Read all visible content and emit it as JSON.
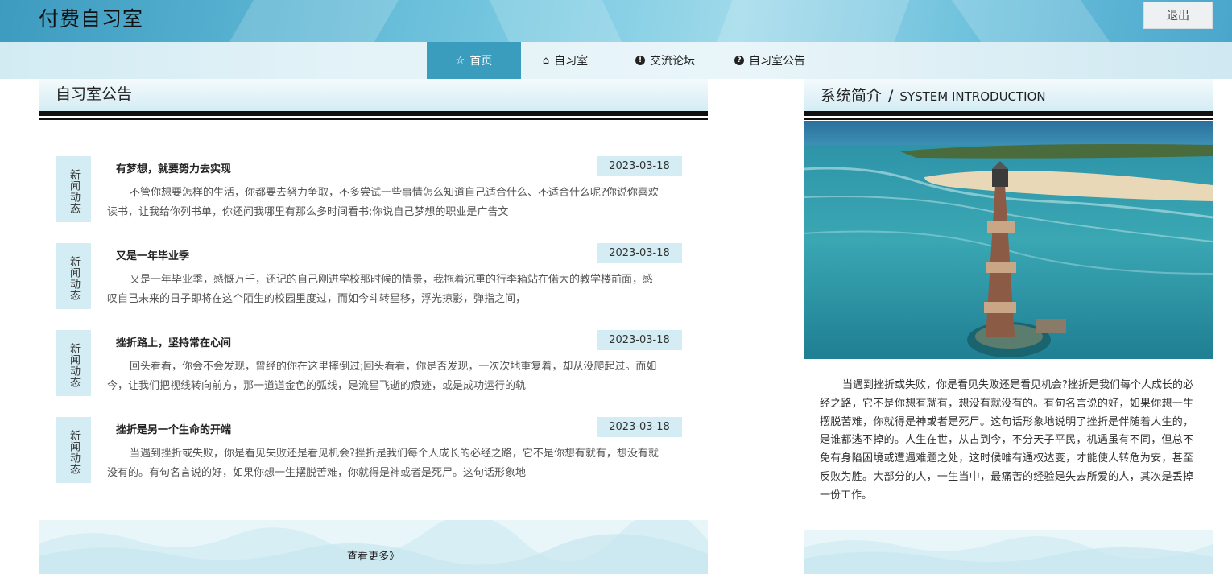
{
  "header": {
    "site_title": "付费自习室",
    "logout_label": "退出"
  },
  "nav": {
    "items": [
      {
        "icon": "star-icon",
        "label": "首页",
        "active": true
      },
      {
        "icon": "home-icon",
        "label": "自习室",
        "active": false
      },
      {
        "icon": "exclamation-circle-icon",
        "label": "交流论坛",
        "active": false
      },
      {
        "icon": "question-circle-icon",
        "label": "自习室公告",
        "active": false
      }
    ]
  },
  "announcements": {
    "title": "自习室公告",
    "tag_label": "新闻动态",
    "items": [
      {
        "title": "有梦想，就要努力去实现",
        "date": "2023-03-18",
        "body": "不管你想要怎样的生活，你都要去努力争取，不多尝试一些事情怎么知道自己适合什么、不适合什么呢?你说你喜欢读书，让我给你列书单，你还问我哪里有那么多时间看书;你说自己梦想的职业是广告文"
      },
      {
        "title": "又是一年毕业季",
        "date": "2023-03-18",
        "body": "又是一年毕业季，感慨万千，还记的自己刚进学校那时候的情景，我拖着沉重的行李箱站在偌大的教学楼前面，感叹自己未来的日子即将在这个陌生的校园里度过，而如今斗转星移，浮光掠影，弹指之间，"
      },
      {
        "title": "挫折路上，坚持常在心间",
        "date": "2023-03-18",
        "body": "回头看看，你会不会发现，曾经的你在这里摔倒过;回头看看，你是否发现，一次次地重复着，却从没爬起过。而如今，让我们把视线转向前方，那一道道金色的弧线，是流星飞逝的痕迹，或是成功运行的轨"
      },
      {
        "title": "挫折是另一个生命的开端",
        "date": "2023-03-18",
        "body": "当遇到挫折或失败，你是看见失败还是看见机会?挫折是我们每个人成长的必经之路，它不是你想有就有，想没有就没有的。有句名言说的好，如果你想一生摆脱苦难，你就得是神或者是死尸。这句话形象地"
      }
    ],
    "more_label": "查看更多》"
  },
  "intro": {
    "title_cn": "系统简介",
    "title_sep": "/",
    "title_en": "SYSTEM INTRODUCTION",
    "image_label": "lighthouse-photo",
    "text": "当遇到挫折或失败，你是看见失败还是看见机会?挫折是我们每个人成长的必经之路，它不是你想有就有，想没有就没有的。有句名言说的好，如果你想一生摆脱苦难，你就得是神或者是死尸。这句话形象地说明了挫折是伴随着人生的，是谁都逃不掉的。人生在世，从古到今，不分天子平民，机遇虽有不同，但总不免有身陷困境或遭遇难题之处，这时候唯有通权达变，才能使人转危为安，甚至反败为胜。大部分的人，一生当中，最痛苦的经验是失去所爱的人，其次是丢掉一份工作。"
  }
}
